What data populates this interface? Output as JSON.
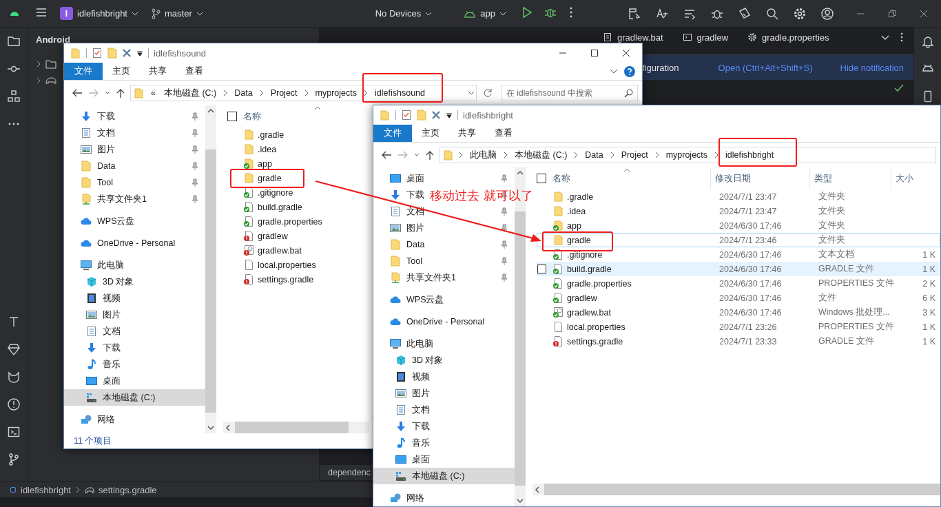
{
  "ide": {
    "project_badge": "I",
    "project": "idlefishbright",
    "branch": "master",
    "device": "No Devices",
    "run_config": "app",
    "tool_window_title": "Android",
    "editor_tabs": [
      {
        "label": "gradlew.bat",
        "selected": false
      },
      {
        "label": "gradlew",
        "selected": false
      },
      {
        "label": "gradle.properties",
        "selected": false
      }
    ],
    "notification": {
      "text": "figuration",
      "actions": [
        "Open (Ctrl+Alt+Shift+S)",
        "Hide notification"
      ]
    },
    "editor_text": "dependenc",
    "breadcrumb": [
      "idlefishbright",
      "settings.gradle"
    ]
  },
  "explorers": [
    {
      "title": "idlefishsound",
      "window_buttons": true,
      "ribbon_tabs": [
        {
          "label": "文件",
          "selected": true
        },
        {
          "label": "主页",
          "selected": false
        },
        {
          "label": "共享",
          "selected": false
        },
        {
          "label": "查看",
          "selected": false
        }
      ],
      "address_prefix": "«",
      "address": [
        "本地磁盘 (C:)",
        "Data",
        "Project",
        "myprojects",
        "idlefishsound"
      ],
      "search_placeholder": "在 idlefishsound 中搜索",
      "nav": [
        {
          "items": [
            {
              "label": "下载",
              "kind": "download",
              "pinned": true,
              "selected": false
            },
            {
              "label": "文档",
              "kind": "document",
              "pinned": true,
              "selected": false
            },
            {
              "label": "图片",
              "kind": "picture",
              "pinned": true,
              "selected": false
            },
            {
              "label": "Data",
              "kind": "folder",
              "pinned": true,
              "selected": false
            },
            {
              "label": "Tool",
              "kind": "folder",
              "pinned": true,
              "selected": false
            },
            {
              "label": "共享文件夹1",
              "kind": "shared",
              "pinned": true,
              "selected": false
            }
          ]
        },
        {
          "items": [
            {
              "label": "WPS云盘",
              "kind": "cloud",
              "pinned": false,
              "selected": false
            }
          ]
        },
        {
          "items": [
            {
              "label": "OneDrive - Personal",
              "kind": "cloud",
              "pinned": false,
              "selected": false
            }
          ]
        },
        {
          "items": [
            {
              "label": "此电脑",
              "kind": "pc",
              "pinned": false,
              "selected": false,
              "children": [
                {
                  "label": "3D 对象",
                  "kind": "cube",
                  "pinned": false,
                  "selected": false
                },
                {
                  "label": "视频",
                  "kind": "video",
                  "pinned": false,
                  "selected": false
                },
                {
                  "label": "图片",
                  "kind": "picture",
                  "pinned": false,
                  "selected": false
                },
                {
                  "label": "文档",
                  "kind": "document",
                  "pinned": false,
                  "selected": false
                },
                {
                  "label": "下载",
                  "kind": "download",
                  "pinned": false,
                  "selected": false
                },
                {
                  "label": "音乐",
                  "kind": "music",
                  "pinned": false,
                  "selected": false
                },
                {
                  "label": "桌面",
                  "kind": "desktop",
                  "pinned": false,
                  "selected": false
                },
                {
                  "label": "本地磁盘 (C:)",
                  "kind": "drive",
                  "pinned": false,
                  "selected": true
                }
              ]
            }
          ]
        },
        {
          "items": [
            {
              "label": "网络",
              "kind": "network",
              "pinned": false,
              "selected": false
            }
          ]
        }
      ],
      "all_selected": false,
      "columns": [
        "名称"
      ],
      "files": [
        {
          "name": ".gradle",
          "kind": "folder",
          "synced": false,
          "error": false,
          "selected": false,
          "hovered": false
        },
        {
          "name": ".idea",
          "kind": "folder",
          "synced": false,
          "error": false,
          "selected": false,
          "hovered": false
        },
        {
          "name": "app",
          "kind": "folder",
          "synced": true,
          "error": false,
          "selected": false,
          "hovered": false
        },
        {
          "name": "gradle",
          "kind": "folder",
          "synced": false,
          "error": false,
          "selected": false,
          "hovered": false
        },
        {
          "name": ".gitignore",
          "kind": "file",
          "synced": true,
          "error": false,
          "selected": false,
          "hovered": false
        },
        {
          "name": "build.gradle",
          "kind": "file",
          "synced": true,
          "error": false,
          "selected": false,
          "hovered": false
        },
        {
          "name": "gradle.properties",
          "kind": "file",
          "synced": true,
          "error": false,
          "selected": false,
          "hovered": false
        },
        {
          "name": "gradlew",
          "kind": "file",
          "synced": false,
          "error": true,
          "selected": false,
          "hovered": false
        },
        {
          "name": "gradlew.bat",
          "kind": "batch",
          "synced": false,
          "error": true,
          "selected": false,
          "hovered": false
        },
        {
          "name": "local.properties",
          "kind": "file",
          "synced": false,
          "error": false,
          "selected": false,
          "hovered": false
        },
        {
          "name": "settings.gradle",
          "kind": "file",
          "synced": false,
          "error": true,
          "selected": false,
          "hovered": false
        }
      ],
      "status_text": "11 个项目"
    },
    {
      "title": "idlefishbright",
      "window_buttons": false,
      "ribbon_tabs": [
        {
          "label": "文件",
          "selected": true
        },
        {
          "label": "主页",
          "selected": false
        },
        {
          "label": "共享",
          "selected": false
        },
        {
          "label": "查看",
          "selected": false
        }
      ],
      "address": [
        "此电脑",
        "本地磁盘 (C:)",
        "Data",
        "Project",
        "myprojects",
        "idlefishbright"
      ],
      "nav": [
        {
          "items": [
            {
              "label": "桌面",
              "kind": "desktop",
              "pinned": true,
              "selected": false
            },
            {
              "label": "下载",
              "kind": "download",
              "pinned": true,
              "selected": false
            },
            {
              "label": "文档",
              "kind": "document",
              "pinned": true,
              "selected": false
            },
            {
              "label": "图片",
              "kind": "picture",
              "pinned": true,
              "selected": false
            },
            {
              "label": "Data",
              "kind": "folder",
              "pinned": true,
              "selected": false
            },
            {
              "label": "Tool",
              "kind": "folder",
              "pinned": true,
              "selected": false
            },
            {
              "label": "共享文件夹1",
              "kind": "shared",
              "pinned": true,
              "selected": false
            }
          ]
        },
        {
          "items": [
            {
              "label": "WPS云盘",
              "kind": "cloud",
              "pinned": false,
              "selected": false
            }
          ]
        },
        {
          "items": [
            {
              "label": "OneDrive - Personal",
              "kind": "cloud",
              "pinned": false,
              "selected": false
            }
          ]
        },
        {
          "items": [
            {
              "label": "此电脑",
              "kind": "pc",
              "pinned": false,
              "selected": false,
              "children": [
                {
                  "label": "3D 对象",
                  "kind": "cube",
                  "pinned": false,
                  "selected": false
                },
                {
                  "label": "视频",
                  "kind": "video",
                  "pinned": false,
                  "selected": false
                },
                {
                  "label": "图片",
                  "kind": "picture",
                  "pinned": false,
                  "selected": false
                },
                {
                  "label": "文档",
                  "kind": "document",
                  "pinned": false,
                  "selected": false
                },
                {
                  "label": "下载",
                  "kind": "download",
                  "pinned": false,
                  "selected": false
                },
                {
                  "label": "音乐",
                  "kind": "music",
                  "pinned": false,
                  "selected": false
                },
                {
                  "label": "桌面",
                  "kind": "desktop",
                  "pinned": false,
                  "selected": false
                },
                {
                  "label": "本地磁盘 (C:)",
                  "kind": "drive",
                  "pinned": false,
                  "selected": true
                }
              ]
            }
          ]
        },
        {
          "items": [
            {
              "label": "网络",
              "kind": "network",
              "pinned": false,
              "selected": false
            }
          ]
        }
      ],
      "all_selected": false,
      "columns": [
        "名称",
        "修改日期",
        "类型",
        "大小"
      ],
      "files": [
        {
          "name": ".gradle",
          "kind": "folder",
          "synced": false,
          "error": false,
          "date": "2024/7/1 23:47",
          "type": "文件夹",
          "selected": false,
          "hovered": false
        },
        {
          "name": ".idea",
          "kind": "folder",
          "synced": false,
          "error": false,
          "date": "2024/7/1 23:47",
          "type": "文件夹",
          "selected": false,
          "hovered": false
        },
        {
          "name": "app",
          "kind": "folder",
          "synced": true,
          "error": false,
          "date": "2024/6/30 17:46",
          "type": "文件夹",
          "selected": false,
          "hovered": false
        },
        {
          "name": "gradle",
          "kind": "folder",
          "synced": false,
          "error": false,
          "date": "2024/7/1 23:46",
          "type": "文件夹",
          "selected": true,
          "hovered": false
        },
        {
          "name": ".gitignore",
          "kind": "file",
          "synced": true,
          "error": false,
          "date": "2024/6/30 17:46",
          "type": "文本文档",
          "size": "1 K",
          "selected": false,
          "hovered": false
        },
        {
          "name": "build.gradle",
          "kind": "file",
          "synced": true,
          "error": false,
          "date": "2024/6/30 17:46",
          "type": "GRADLE 文件",
          "size": "1 K",
          "selected": false,
          "hovered": true
        },
        {
          "name": "gradle.properties",
          "kind": "file",
          "synced": true,
          "error": false,
          "date": "2024/6/30 17:46",
          "type": "PROPERTIES 文件",
          "size": "2 K",
          "selected": false,
          "hovered": false
        },
        {
          "name": "gradlew",
          "kind": "file",
          "synced": true,
          "error": false,
          "date": "2024/6/30 17:46",
          "type": "文件",
          "size": "6 K",
          "selected": false,
          "hovered": false
        },
        {
          "name": "gradlew.bat",
          "kind": "batch",
          "synced": true,
          "error": false,
          "date": "2024/6/30 17:46",
          "type": "Windows 批处理...",
          "size": "3 K",
          "selected": false,
          "hovered": false
        },
        {
          "name": "local.properties",
          "kind": "file",
          "synced": false,
          "error": false,
          "date": "2024/7/1 23:26",
          "type": "PROPERTIES 文件",
          "size": "1 K",
          "selected": false,
          "hovered": false
        },
        {
          "name": "settings.gradle",
          "kind": "file",
          "synced": false,
          "error": true,
          "date": "2024/7/1 23:33",
          "type": "GRADLE 文件",
          "size": "1 K",
          "selected": false,
          "hovered": false
        }
      ]
    }
  ],
  "annotation": {
    "text": "移动过去 就可以了"
  }
}
